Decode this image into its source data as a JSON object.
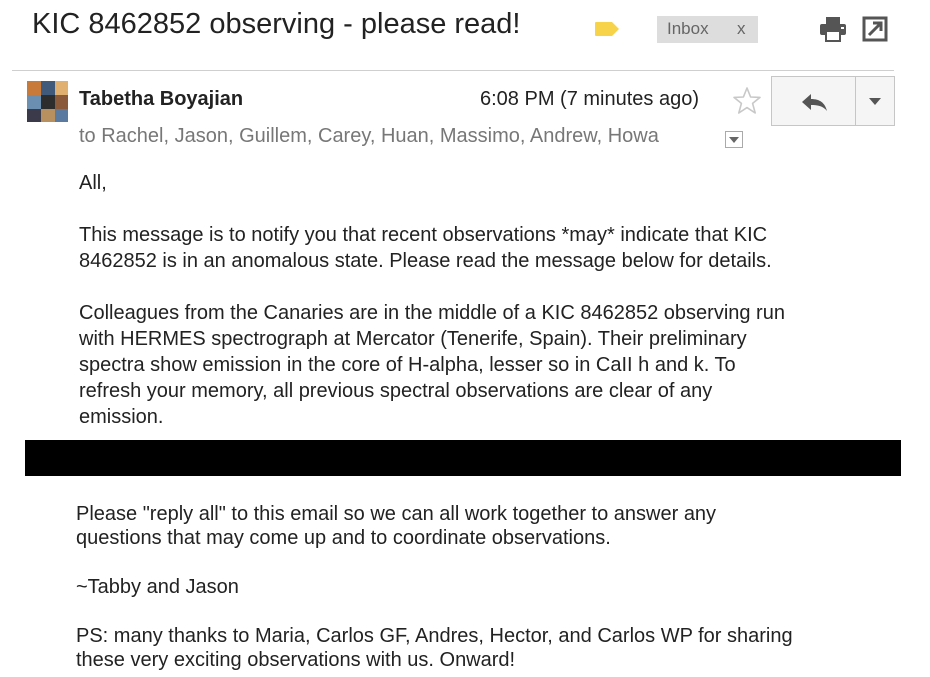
{
  "header": {
    "subject": "KIC 8462852 observing - please read!",
    "label_chip": {
      "text": "Inbox",
      "close": "x"
    },
    "label_color": "#f7d34a"
  },
  "message": {
    "sender": "Tabetha Boyajian",
    "time": "6:08 PM (7 minutes ago)",
    "recipients": "to Rachel, Jason, Guillem, Carey, Huan, Massimo, Andrew, Howa",
    "greeting": "All,",
    "para1": [
      "This message is to notify you that recent observations *may* indicate that KIC",
      "8462852 is in an anomalous state.  Please read the message below for details."
    ],
    "para2": [
      "Colleagues from the Canaries are in the middle of a KIC 8462852 observing run",
      "with HERMES spectrograph at Mercator (Tenerife, Spain).  Their preliminary",
      "spectra show emission in the core of H-alpha, lesser so in CaII h and k. To",
      "refresh your memory, all previous spectral observations are clear of any",
      "emission."
    ],
    "para3": [
      "Please \"reply all\" to this email so we can all work together to answer any",
      "questions that may come up and to coordinate observations."
    ],
    "signoff": "~Tabby and Jason",
    "ps": [
      "PS: many thanks to Maria, Carlos GF, Andres, Hector, and Carlos WP for sharing",
      "these very exciting observations with us. Onward!"
    ]
  },
  "icons": {
    "label": "label-tag-icon",
    "print": "print-icon",
    "popout": "new-window-icon",
    "star": "star-icon",
    "reply": "reply-arrow-icon",
    "more": "dropdown-arrow-icon",
    "recipients_toggle": "show-details-icon"
  }
}
